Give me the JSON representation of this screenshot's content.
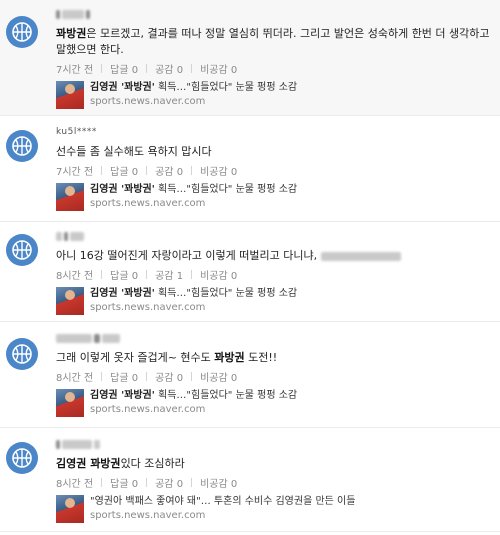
{
  "comments": [
    {
      "nick_suffix": "",
      "text_prefix": "",
      "text_bold": "꽈방권",
      "text_suffix": "은 모르겠고, 결과를 떠나 정말 열심히 뛰더라. 그리고 발언은 성숙하게 한번 더 생각하고 말했으면 한다.",
      "time": "7시간 전",
      "reply": "답글 0",
      "like": "공감 0",
      "dislike": "비공감 0",
      "news_title_bold": "김영권 '꽈방권'",
      "news_title_rest": " 획득…\"힘들었다\" 눈물 펑펑 소감",
      "news_source": "sports.news.naver.com"
    },
    {
      "nick_suffix": "ku5l****",
      "text_prefix": "선수들 좀 실수해도 욕하지 맙시다",
      "text_bold": "",
      "text_suffix": "",
      "time": "7시간 전",
      "reply": "답글 0",
      "like": "공감 0",
      "dislike": "비공감 0",
      "news_title_bold": "김영권 '꽈방권'",
      "news_title_rest": " 획득…\"힘들었다\" 눈물 펑펑 소감",
      "news_source": "sports.news.naver.com"
    },
    {
      "nick_suffix": "",
      "text_prefix": "아니 16강 떨어진게 자랑이라고 이렇게 떠벌리고 다니냐,",
      "text_bold": "",
      "text_suffix": "",
      "time": "8시간 전",
      "reply": "답글 0",
      "like": "공감 1",
      "dislike": "비공감 0",
      "news_title_bold": "김영권 '꽈방권'",
      "news_title_rest": " 획득…\"힘들었다\" 눈물 펑펑 소감",
      "news_source": "sports.news.naver.com"
    },
    {
      "nick_suffix": "",
      "text_prefix": "그래 이렇게 옷자 즐겁게~ 현수도 ",
      "text_bold": "꽈방권",
      "text_suffix": " 도전!!",
      "time": "8시간 전",
      "reply": "답글 0",
      "like": "공감 0",
      "dislike": "비공감 0",
      "news_title_bold": "김영권 '꽈방권'",
      "news_title_rest": " 획득…\"힘들었다\" 눈물 펑펑 소감",
      "news_source": "sports.news.naver.com"
    },
    {
      "nick_suffix": "",
      "text_prefix": "",
      "text_bold": "김영권 꽈방권",
      "text_suffix": "있다 조심하라",
      "time": "8시간 전",
      "reply": "답글 0",
      "like": "공감 0",
      "dislike": "비공감 0",
      "news_title_bold": "",
      "news_title_rest": "\"영권아 백패스 좋여야 돼\"… 투혼의 수비수 김영권을 만든 이들",
      "news_source": "sports.news.naver.com"
    }
  ],
  "colors": {
    "avatar": "#4a86c8",
    "first_bg": "#f7f7f7"
  },
  "icons": {
    "avatar": "basketball-icon",
    "thumb": "news-thumbnail"
  }
}
